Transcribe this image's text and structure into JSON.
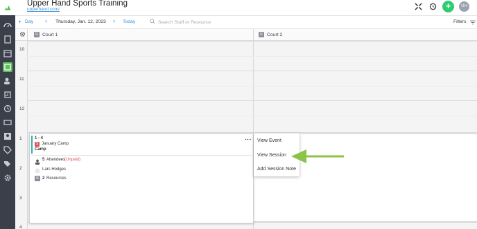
{
  "app": {
    "title": "Upper Hand Sports Training",
    "subtitle": "upperhand.com/",
    "avatar_initials": "UH",
    "add_label": "+"
  },
  "toolbar": {
    "view_label": "Day",
    "date_label": "Thursday, Jan. 12, 2023",
    "today_label": "Today",
    "search_placeholder": "Search Staff or Resource",
    "filters_label": "Filters"
  },
  "columns": [
    {
      "badge": "R",
      "label": "Court 1"
    },
    {
      "badge": "R",
      "label": "Court 2"
    }
  ],
  "hours": [
    "10",
    "11",
    "12",
    "1",
    "2",
    "3",
    "4"
  ],
  "event": {
    "time": "1 - 4",
    "badge": "S",
    "event_name": "January Camp",
    "event_type": "Camp",
    "attendees_count": "5",
    "attendees_label": "Attendees",
    "attendees_status": "(Unpaid)",
    "staff": "Lars Hodges",
    "resources_count": "2",
    "resources_label": "Resources"
  },
  "context_menu": {
    "items": [
      "View Event",
      "View Session",
      "Add Session Note"
    ]
  },
  "colors": {
    "nav_bg": "#3b3f4a",
    "accent_green": "#2ecc71",
    "link_blue": "#3a8fd6",
    "unpaid_red": "#e0525a",
    "event_accent": "#2bb5a5",
    "arrow_green": "#8bc34a"
  }
}
